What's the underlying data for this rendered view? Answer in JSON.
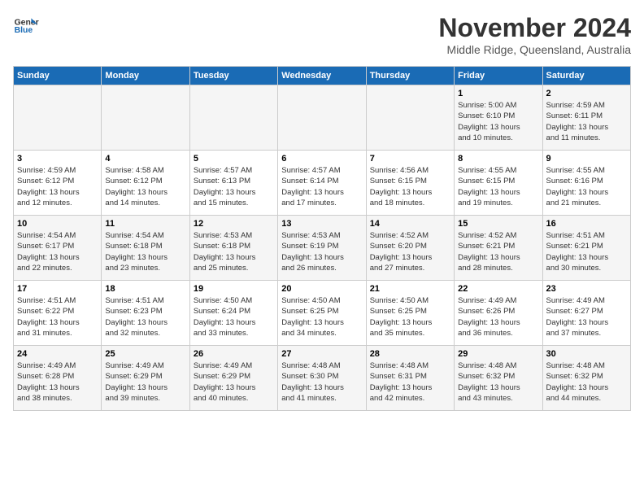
{
  "header": {
    "logo_line1": "General",
    "logo_line2": "Blue",
    "title": "November 2024",
    "subtitle": "Middle Ridge, Queensland, Australia"
  },
  "columns": [
    "Sunday",
    "Monday",
    "Tuesday",
    "Wednesday",
    "Thursday",
    "Friday",
    "Saturday"
  ],
  "weeks": [
    {
      "days": [
        {
          "num": "",
          "info": ""
        },
        {
          "num": "",
          "info": ""
        },
        {
          "num": "",
          "info": ""
        },
        {
          "num": "",
          "info": ""
        },
        {
          "num": "",
          "info": ""
        },
        {
          "num": "1",
          "info": "Sunrise: 5:00 AM\nSunset: 6:10 PM\nDaylight: 13 hours\nand 10 minutes."
        },
        {
          "num": "2",
          "info": "Sunrise: 4:59 AM\nSunset: 6:11 PM\nDaylight: 13 hours\nand 11 minutes."
        }
      ]
    },
    {
      "days": [
        {
          "num": "3",
          "info": "Sunrise: 4:59 AM\nSunset: 6:12 PM\nDaylight: 13 hours\nand 12 minutes."
        },
        {
          "num": "4",
          "info": "Sunrise: 4:58 AM\nSunset: 6:12 PM\nDaylight: 13 hours\nand 14 minutes."
        },
        {
          "num": "5",
          "info": "Sunrise: 4:57 AM\nSunset: 6:13 PM\nDaylight: 13 hours\nand 15 minutes."
        },
        {
          "num": "6",
          "info": "Sunrise: 4:57 AM\nSunset: 6:14 PM\nDaylight: 13 hours\nand 17 minutes."
        },
        {
          "num": "7",
          "info": "Sunrise: 4:56 AM\nSunset: 6:15 PM\nDaylight: 13 hours\nand 18 minutes."
        },
        {
          "num": "8",
          "info": "Sunrise: 4:55 AM\nSunset: 6:15 PM\nDaylight: 13 hours\nand 19 minutes."
        },
        {
          "num": "9",
          "info": "Sunrise: 4:55 AM\nSunset: 6:16 PM\nDaylight: 13 hours\nand 21 minutes."
        }
      ]
    },
    {
      "days": [
        {
          "num": "10",
          "info": "Sunrise: 4:54 AM\nSunset: 6:17 PM\nDaylight: 13 hours\nand 22 minutes."
        },
        {
          "num": "11",
          "info": "Sunrise: 4:54 AM\nSunset: 6:18 PM\nDaylight: 13 hours\nand 23 minutes."
        },
        {
          "num": "12",
          "info": "Sunrise: 4:53 AM\nSunset: 6:18 PM\nDaylight: 13 hours\nand 25 minutes."
        },
        {
          "num": "13",
          "info": "Sunrise: 4:53 AM\nSunset: 6:19 PM\nDaylight: 13 hours\nand 26 minutes."
        },
        {
          "num": "14",
          "info": "Sunrise: 4:52 AM\nSunset: 6:20 PM\nDaylight: 13 hours\nand 27 minutes."
        },
        {
          "num": "15",
          "info": "Sunrise: 4:52 AM\nSunset: 6:21 PM\nDaylight: 13 hours\nand 28 minutes."
        },
        {
          "num": "16",
          "info": "Sunrise: 4:51 AM\nSunset: 6:21 PM\nDaylight: 13 hours\nand 30 minutes."
        }
      ]
    },
    {
      "days": [
        {
          "num": "17",
          "info": "Sunrise: 4:51 AM\nSunset: 6:22 PM\nDaylight: 13 hours\nand 31 minutes."
        },
        {
          "num": "18",
          "info": "Sunrise: 4:51 AM\nSunset: 6:23 PM\nDaylight: 13 hours\nand 32 minutes."
        },
        {
          "num": "19",
          "info": "Sunrise: 4:50 AM\nSunset: 6:24 PM\nDaylight: 13 hours\nand 33 minutes."
        },
        {
          "num": "20",
          "info": "Sunrise: 4:50 AM\nSunset: 6:25 PM\nDaylight: 13 hours\nand 34 minutes."
        },
        {
          "num": "21",
          "info": "Sunrise: 4:50 AM\nSunset: 6:25 PM\nDaylight: 13 hours\nand 35 minutes."
        },
        {
          "num": "22",
          "info": "Sunrise: 4:49 AM\nSunset: 6:26 PM\nDaylight: 13 hours\nand 36 minutes."
        },
        {
          "num": "23",
          "info": "Sunrise: 4:49 AM\nSunset: 6:27 PM\nDaylight: 13 hours\nand 37 minutes."
        }
      ]
    },
    {
      "days": [
        {
          "num": "24",
          "info": "Sunrise: 4:49 AM\nSunset: 6:28 PM\nDaylight: 13 hours\nand 38 minutes."
        },
        {
          "num": "25",
          "info": "Sunrise: 4:49 AM\nSunset: 6:29 PM\nDaylight: 13 hours\nand 39 minutes."
        },
        {
          "num": "26",
          "info": "Sunrise: 4:49 AM\nSunset: 6:29 PM\nDaylight: 13 hours\nand 40 minutes."
        },
        {
          "num": "27",
          "info": "Sunrise: 4:48 AM\nSunset: 6:30 PM\nDaylight: 13 hours\nand 41 minutes."
        },
        {
          "num": "28",
          "info": "Sunrise: 4:48 AM\nSunset: 6:31 PM\nDaylight: 13 hours\nand 42 minutes."
        },
        {
          "num": "29",
          "info": "Sunrise: 4:48 AM\nSunset: 6:32 PM\nDaylight: 13 hours\nand 43 minutes."
        },
        {
          "num": "30",
          "info": "Sunrise: 4:48 AM\nSunset: 6:32 PM\nDaylight: 13 hours\nand 44 minutes."
        }
      ]
    }
  ]
}
